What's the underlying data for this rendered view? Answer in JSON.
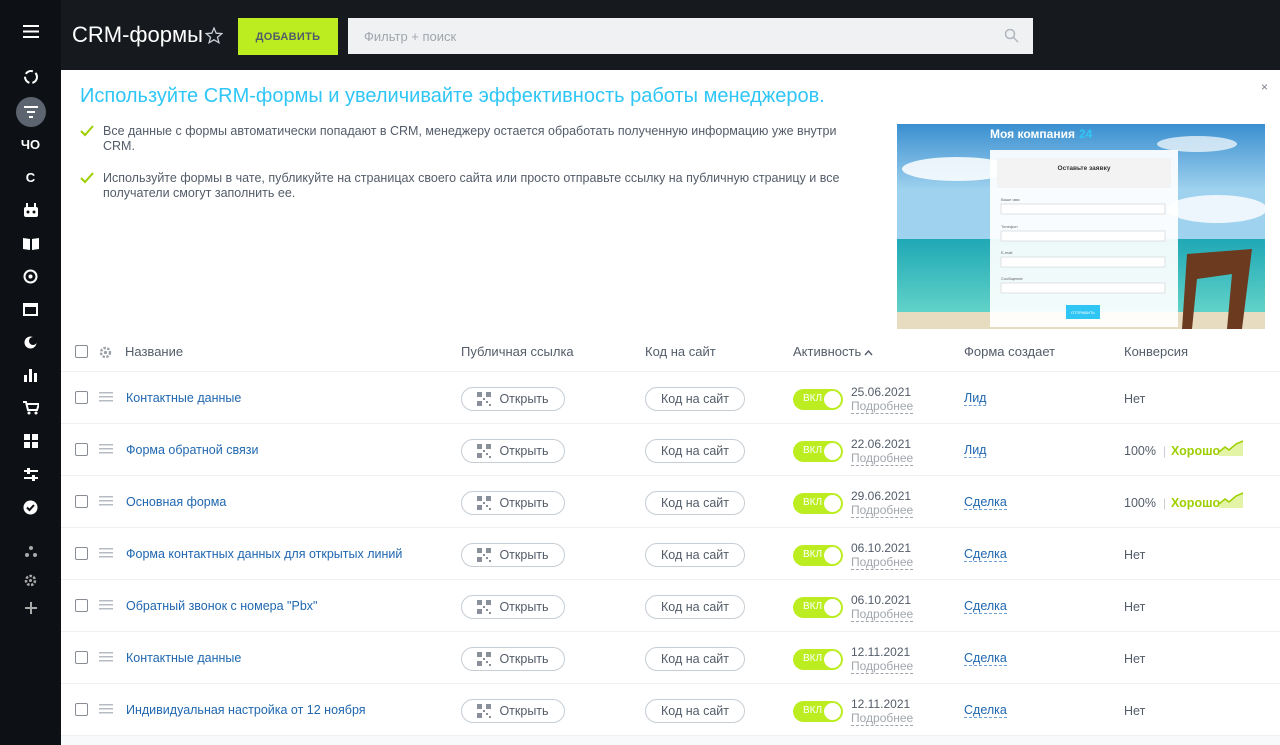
{
  "rail": {
    "labels": [
      "ЧО",
      "С"
    ]
  },
  "header": {
    "title": "CRM-формы",
    "add_label": "ДОБАВИТЬ",
    "search_placeholder": "Фильтр + поиск"
  },
  "banner": {
    "title": "Используйте CRM-формы и увеличивайте эффективность работы менеджеров.",
    "points": [
      "Все данные с формы автоматически попадают в CRM, менеджеру остается обработать полученную информацию уже внутри CRM.",
      "Используйте формы в чате, публикуйте на страницах своего сайта или просто отправьте ссылку на публичную страницу и все получатели смогут заполнить ее."
    ],
    "close": "×",
    "image": {
      "company_name": "Моя компания",
      "company_number": "24",
      "form_title": "Оставьте заявку",
      "fields": [
        "Ваше имя",
        "Телефон",
        "E-mail",
        "Сообщение"
      ],
      "submit": "ОТПРАВИТЬ"
    }
  },
  "table": {
    "columns": {
      "name": "Название",
      "public_link": "Публичная ссылка",
      "site_code": "Код на сайт",
      "activity": "Активность",
      "creates": "Форма создает",
      "conversion": "Конверсия"
    },
    "open_label": "Открыть",
    "code_label": "Код на сайт",
    "toggle_label": "ВКЛ",
    "more_label": "Подробнее",
    "rows": [
      {
        "name": "Контактные данные",
        "date": "25.06.2021",
        "entity": "Лид",
        "conversion": "Нет",
        "quality": ""
      },
      {
        "name": "Форма обратной связи",
        "date": "22.06.2021",
        "entity": "Лид",
        "conversion": "100%",
        "quality": "Хорошо"
      },
      {
        "name": "Основная форма",
        "date": "29.06.2021",
        "entity": "Сделка",
        "conversion": "100%",
        "quality": "Хорошо"
      },
      {
        "name": "Форма контактных данных для открытых линий",
        "date": "06.10.2021",
        "entity": "Сделка",
        "conversion": "Нет",
        "quality": ""
      },
      {
        "name": "Обратный звонок с номера \"Pbx\"",
        "date": "06.10.2021",
        "entity": "Сделка",
        "conversion": "Нет",
        "quality": ""
      },
      {
        "name": "Контактные данные",
        "date": "12.11.2021",
        "entity": "Сделка",
        "conversion": "Нет",
        "quality": ""
      },
      {
        "name": "Индивидуальная настройка от 12 ноября",
        "date": "12.11.2021",
        "entity": "Сделка",
        "conversion": "Нет",
        "quality": ""
      }
    ]
  },
  "colors": {
    "accent_green": "#bbed21",
    "link_blue": "#2067b0",
    "banner_title": "#2fc6f6",
    "quality_green": "#9dcf00"
  }
}
